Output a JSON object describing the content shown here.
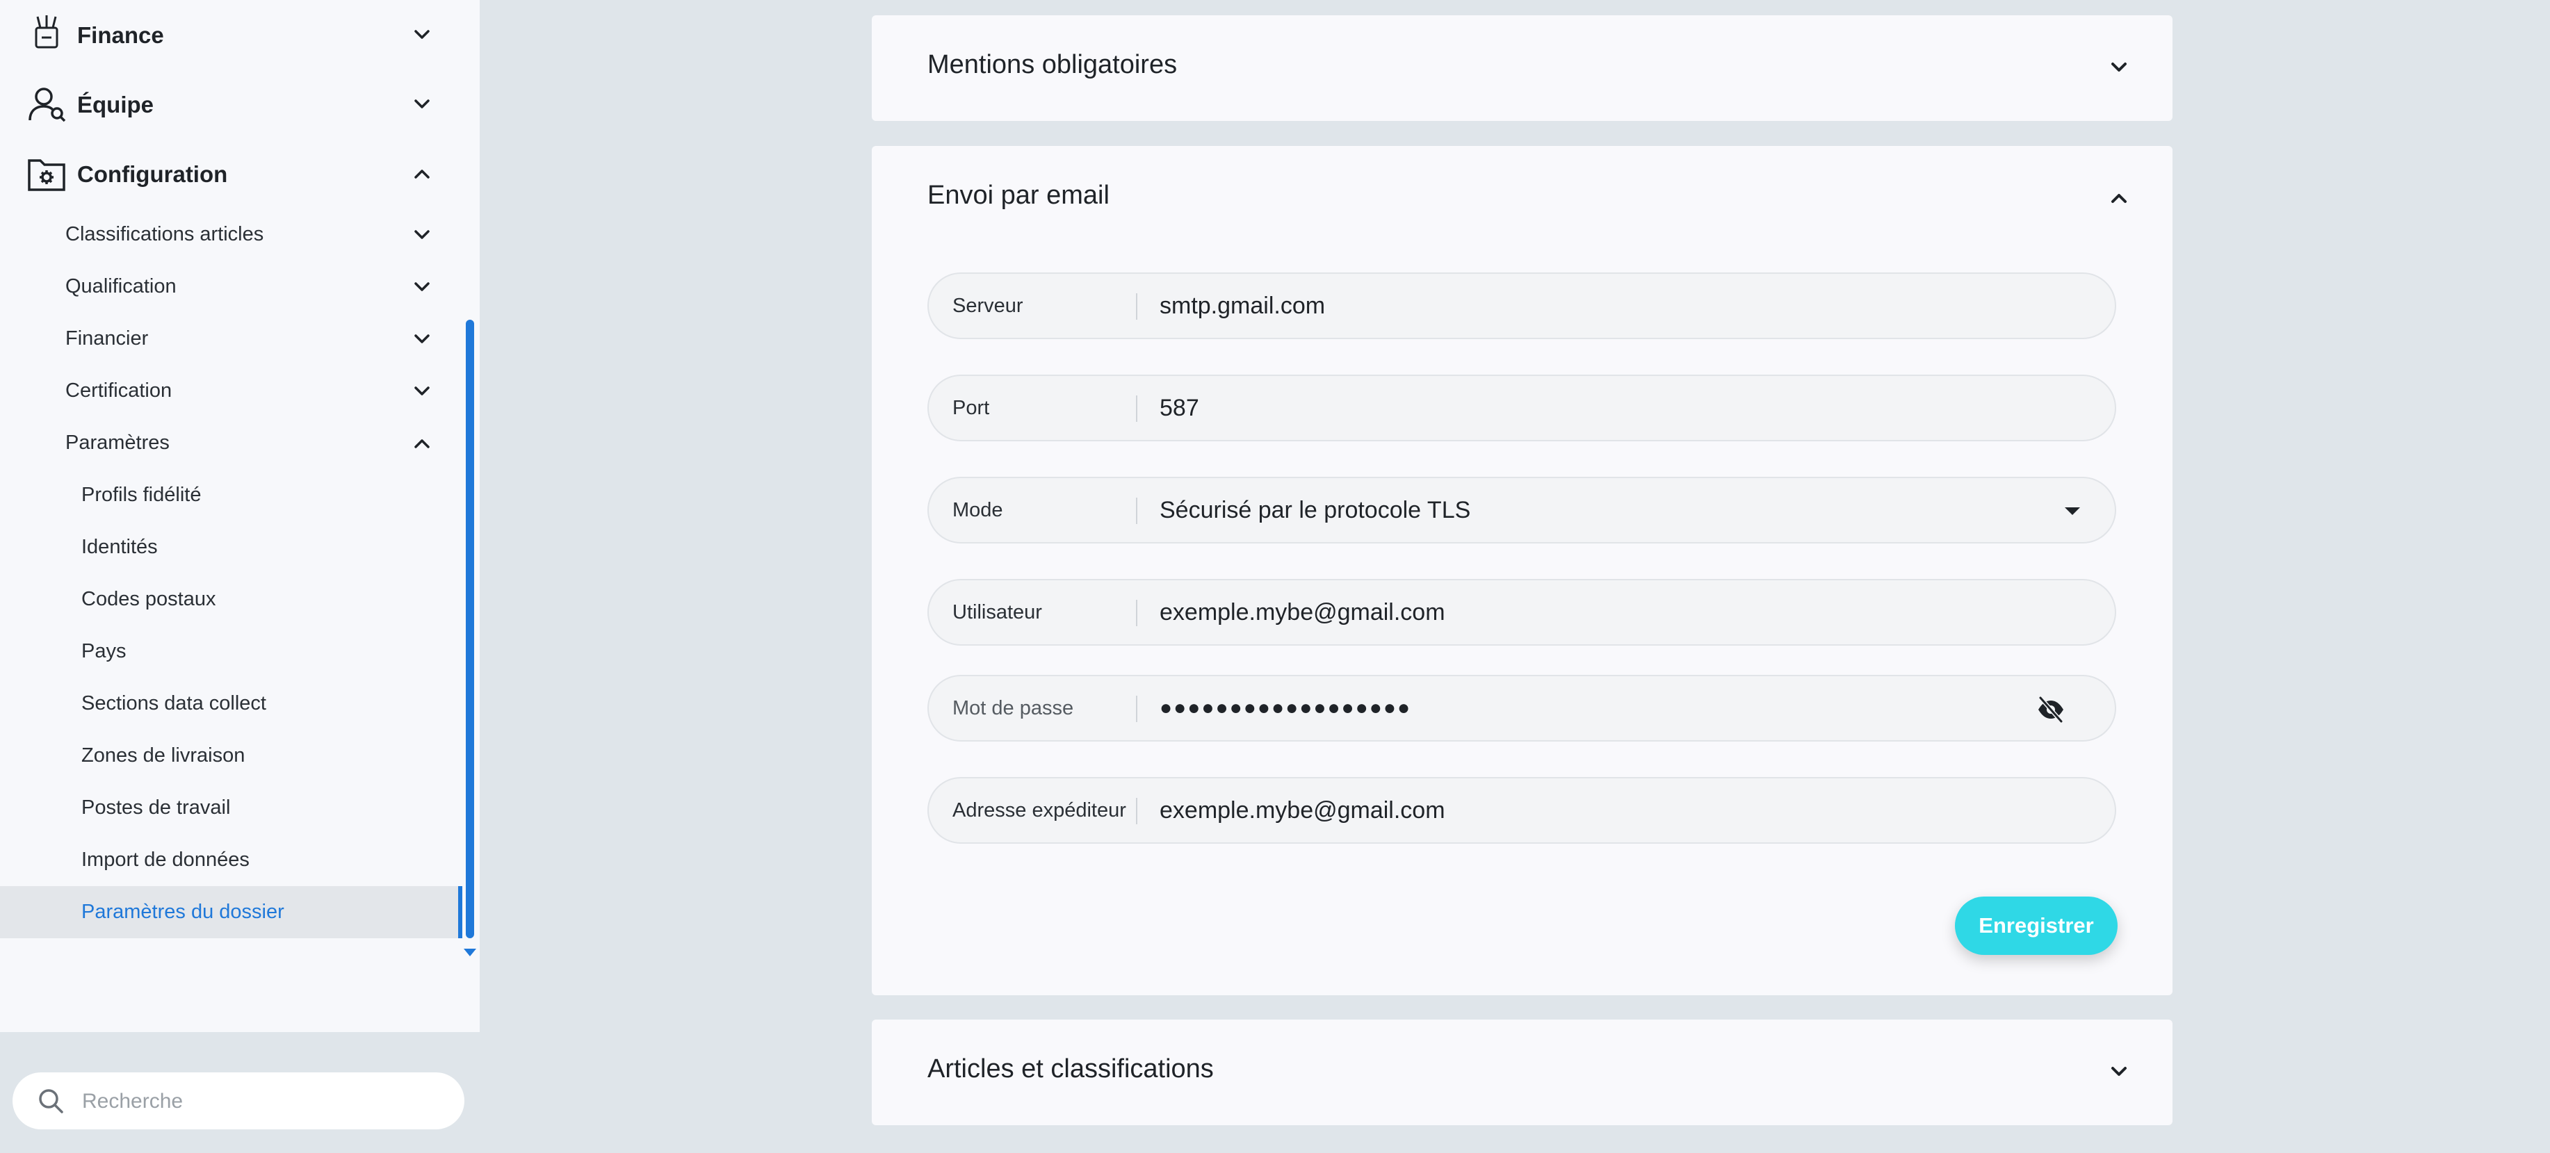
{
  "sidebar": {
    "top_items": [
      {
        "label": "Finance",
        "icon": "money-icon",
        "expanded": false
      },
      {
        "label": "Équipe",
        "icon": "team-icon",
        "expanded": false
      },
      {
        "label": "Configuration",
        "icon": "settings-folder-icon",
        "expanded": true
      }
    ],
    "sub_items": [
      {
        "label": "Classifications articles",
        "expanded": false
      },
      {
        "label": "Qualification",
        "expanded": false
      },
      {
        "label": "Financier",
        "expanded": false
      },
      {
        "label": "Certification",
        "expanded": false
      },
      {
        "label": "Paramètres",
        "expanded": true
      }
    ],
    "param_items": [
      {
        "label": "Profils fidélité"
      },
      {
        "label": "Identités"
      },
      {
        "label": "Codes postaux"
      },
      {
        "label": "Pays"
      },
      {
        "label": "Sections data collect"
      },
      {
        "label": "Zones de livraison"
      },
      {
        "label": "Postes de travail"
      },
      {
        "label": "Import de données"
      },
      {
        "label": "Paramètres du dossier",
        "active": true
      }
    ],
    "search": {
      "placeholder": "Recherche",
      "value": ""
    }
  },
  "main": {
    "sections": [
      {
        "title": "Mentions obligatoires",
        "expanded": false
      },
      {
        "title": "Envoi par email",
        "expanded": true
      },
      {
        "title": "Articles et classifications",
        "expanded": false
      }
    ],
    "email_form": {
      "server": {
        "label": "Serveur",
        "value": "smtp.gmail.com"
      },
      "port": {
        "label": "Port",
        "value": "587"
      },
      "mode": {
        "label": "Mode",
        "value": "Sécurisé par le protocole TLS"
      },
      "user": {
        "label": "Utilisateur",
        "value": "exemple.mybe@gmail.com"
      },
      "password": {
        "label": "Mot de passe",
        "value": "●●●●●●●●●●●●●●●●●●"
      },
      "sender": {
        "label": "Adresse expéditeur",
        "value": "exemple.mybe@gmail.com"
      },
      "save_label": "Enregistrer"
    }
  },
  "colors": {
    "background": "#dfe5ea",
    "sidebar": "#f7f8fb",
    "accent_blue": "#1f78d9",
    "save_button": "#2fd8e6"
  }
}
